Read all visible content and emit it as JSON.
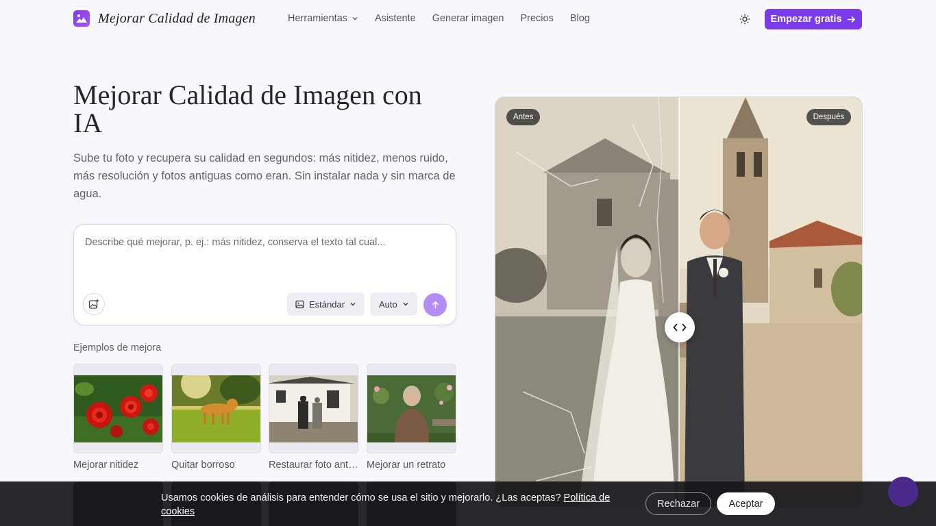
{
  "nav": {
    "brand": "Mejorar Calidad de Imagen",
    "links": [
      "Herramientas",
      "Asistente",
      "Generar imagen",
      "Precios",
      "Blog"
    ],
    "cta": "Empezar gratis"
  },
  "hero": {
    "title": "Mejorar Calidad de Imagen con IA",
    "subtitle": "Sube tu foto y recupera su calidad en segundos: más nitidez, menos ruido, más resolución y fotos antiguas como eran. Sin instalar nada y sin marca de agua."
  },
  "prompt": {
    "placeholder": "Describe qué mejorar, p. ej.: más nitidez, conserva el texto tal cual...",
    "quality": "Estándar",
    "mode": "Auto"
  },
  "examples": {
    "title": "Ejemplos de mejora",
    "items": [
      "Mejorar nitidez",
      "Quitar borroso",
      "Restaurar foto antigua",
      "Mejorar un retrato"
    ]
  },
  "compare": {
    "before": "Antes",
    "after": "Después"
  },
  "cookie": {
    "text": "Usamos cookies de análisis para entender cómo se usa el sitio y mejorarlo. ¿Las aceptas?",
    "link": "Política de cookies",
    "reject": "Rechazar",
    "accept": "Aceptar"
  }
}
